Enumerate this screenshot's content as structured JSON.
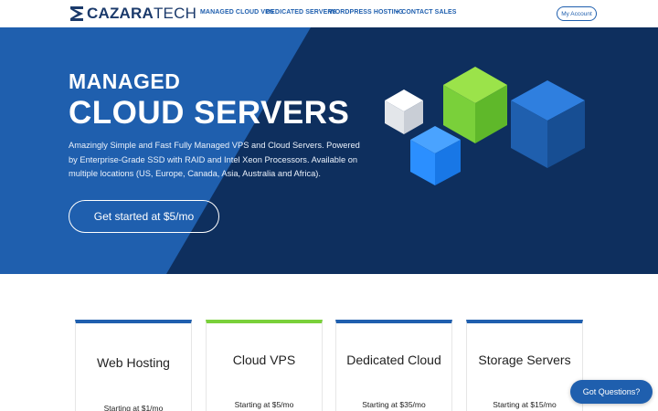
{
  "brand": {
    "name_bold": "CAZARA",
    "name_light": "TECH",
    "primary_color": "#1f5fae",
    "dark_color": "#0e2f5e",
    "accent_green": "#7ad03a"
  },
  "nav": {
    "items": [
      {
        "label": "MANAGED CLOUD VPS"
      },
      {
        "label": "DEDICATED SERVERS"
      },
      {
        "label": "WORDPRESS HOSTING"
      },
      {
        "label": "+ CONTACT SALES"
      }
    ],
    "account_label": "My Account"
  },
  "hero": {
    "eyebrow": "MANAGED",
    "title": "CLOUD SERVERS",
    "description": "Amazingly Simple and Fast Fully Managed VPS and Cloud Servers. Powered by Enterprise-Grade SSD with RAID and Intel Xeon Processors. Available on multiple locations (US, Europe, Canada, Asia, Australia and Africa).",
    "cta_label": "Get started at $5/mo"
  },
  "cards": [
    {
      "title": "Web Hosting",
      "price": "Starting at $1/mo",
      "accent": "blue"
    },
    {
      "title": "Cloud VPS",
      "price": "Starting at $5/mo",
      "accent": "green"
    },
    {
      "title": "Dedicated Cloud",
      "price": "Starting at $35/mo",
      "accent": "blue"
    },
    {
      "title": "Storage Servers",
      "price": "Starting at $15/mo",
      "accent": "blue"
    }
  ],
  "chat": {
    "label": "Got Questions?"
  }
}
